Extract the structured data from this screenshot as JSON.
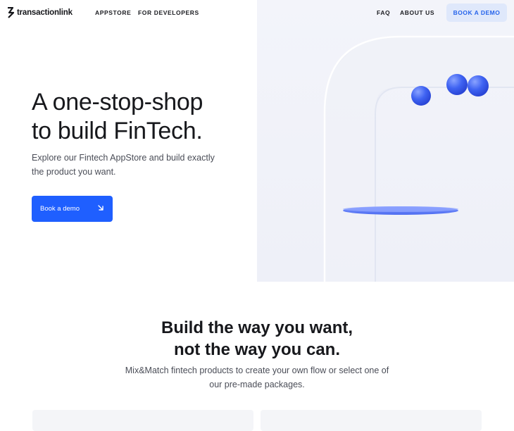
{
  "header": {
    "logo_text": "transactionlink",
    "nav_left": [
      "APPSTORE",
      "FOR DEVELOPERS"
    ],
    "nav_right": [
      "FAQ",
      "ABOUT US"
    ],
    "cta_label": "BOOK A DEMO"
  },
  "hero": {
    "title_line1": "A one-stop-shop",
    "title_line2": "to build FinTech.",
    "subtitle_line1": "Explore our Fintech AppStore and build exactly",
    "subtitle_line2": "the product you want.",
    "button_label": "Book a demo",
    "button_icon": "arrow-down-right-icon"
  },
  "section": {
    "title_line1": "Build the way you want,",
    "title_line2": "not the way you can.",
    "subtitle_line1": "Mix&Match fintech products to create your own flow or select one of",
    "subtitle_line2": "our pre-made packages."
  },
  "colors": {
    "primary": "#1f5fff",
    "cta_bg": "#dfe8fb",
    "cta_text": "#2563eb",
    "text": "#17181c",
    "muted": "#4a4d57",
    "art_bg": "#f0f2f9"
  }
}
